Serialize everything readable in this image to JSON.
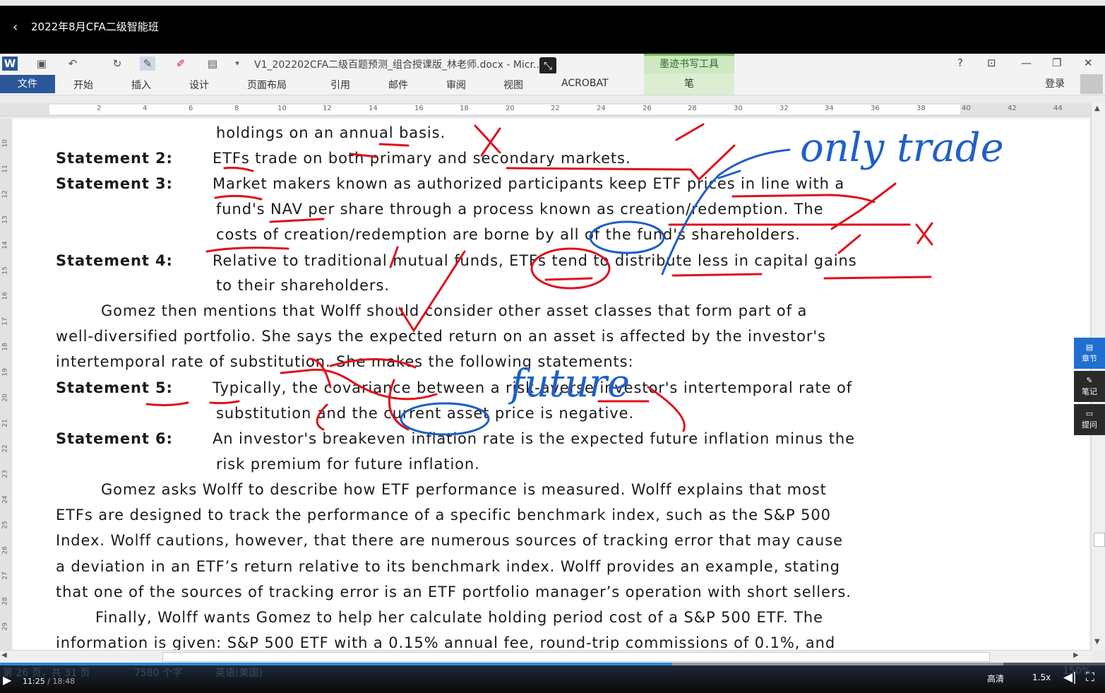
{
  "player": {
    "back_icon": "chevron-left-icon",
    "course_title": "2022年8月CFA二级智能班",
    "current_time": "11:25",
    "total_time": "18:48",
    "time_separator": " / ",
    "played_fraction": 0.608,
    "quality_label": "高清",
    "speed_label": "1.5x",
    "side_panel": [
      {
        "label": "章节",
        "icon": "chapter-icon",
        "glyph": "▤",
        "active": true
      },
      {
        "label": "笔记",
        "icon": "pen-icon",
        "glyph": "✎",
        "active": false
      },
      {
        "label": "提问",
        "icon": "chat-icon",
        "glyph": "▭",
        "active": false
      }
    ],
    "accent_color": "#1f6fd0"
  },
  "word": {
    "doc_title": "V1_202202CFA二级百题预测_组合授课版_林老师.docx - Micr...",
    "ink_tools_tab": "墨迹书写工具",
    "help_label": "?",
    "file_tab": "文件",
    "tabs": [
      "开始",
      "插入",
      "设计",
      "页面布局",
      "引用",
      "邮件",
      "审阅",
      "视图",
      "ACROBAT"
    ],
    "pen_tab": "笔",
    "login_label": "登录",
    "ruler_numbers": [
      "2",
      "4",
      "6",
      "8",
      "10",
      "12",
      "14",
      "16",
      "18",
      "20",
      "22",
      "24",
      "26",
      "28",
      "30",
      "32",
      "34",
      "36",
      "38",
      "40",
      "42",
      "44"
    ],
    "vruler_numbers": [
      "10",
      "11",
      "12",
      "13",
      "14",
      "15",
      "16",
      "17",
      "18",
      "19",
      "20",
      "21",
      "22",
      "23",
      "24",
      "25",
      "26",
      "27",
      "28",
      "29"
    ],
    "status_ghost": {
      "pages": "第 26 页，共 31 页",
      "words": "7580 个字",
      "lang": "英语(美国)",
      "zoom": "150%"
    }
  },
  "document": {
    "lines": [
      {
        "label": "",
        "text": "holdings on an annual basis."
      },
      {
        "label": "Statement 2:",
        "text": "ETFs trade on both primary and secondary markets."
      },
      {
        "label": "Statement 3:",
        "text": "Market makers known as authorized participants keep ETF prices in line with a"
      },
      {
        "label": "",
        "text": "fund's NAV per share through a process known as creation/redemption. The"
      },
      {
        "label": "",
        "text": "costs of creation/redemption are borne by all of the fund's shareholders."
      },
      {
        "label": "Statement 4:",
        "text": "Relative to traditional mutual funds, ETFs tend to distribute less in capital gains"
      },
      {
        "label": "",
        "text": "to their shareholders."
      },
      {
        "label": "",
        "text": "Gomez then mentions that Wolff should consider other asset classes that form part of a"
      },
      {
        "label": "",
        "text": "well-diversified portfolio. She says the expected return on an asset is affected by the investor's"
      },
      {
        "label": "",
        "text": "intertemporal rate of substitution. She makes the following statements:"
      },
      {
        "label": "Statement 5:",
        "text": "Typically, the covariance between a risk-averse investor's intertemporal rate of"
      },
      {
        "label": "",
        "text": "substitution and the current asset price is negative."
      },
      {
        "label": "Statement 6:",
        "text": "An investor's breakeven inflation rate is the expected future inflation minus the"
      },
      {
        "label": "",
        "text": "risk premium for future inflation."
      },
      {
        "label": "",
        "text": "Gomez asks Wolff to describe how ETF performance is measured. Wolff explains that most"
      },
      {
        "label": "",
        "text": "ETFs are designed to track the performance of a specific benchmark index, such as the S&P 500"
      },
      {
        "label": "",
        "text": "Index. Wolff cautions, however, that there are numerous sources of tracking error that may cause"
      },
      {
        "label": "",
        "text": "a deviation in an ETF’s return relative to its benchmark index. Wolff provides an example, stating"
      },
      {
        "label": "",
        "text": "that one of the sources of tracking error is an ETF portfolio manager’s operation with short sellers."
      },
      {
        "label": "",
        "text": "Finally, Wolff wants Gomez to help her calculate holding period cost of a S&P 500 ETF. The"
      },
      {
        "label": "",
        "text": "information is given: S&P 500 ETF with a 0.15% annual fee, round-trip commissions of 0.1%, and"
      }
    ],
    "handwriting": {
      "only_trade": "only trade",
      "future": "future"
    },
    "ink_colors": {
      "red": "#e0101c",
      "blue": "#1f5fc8"
    }
  }
}
